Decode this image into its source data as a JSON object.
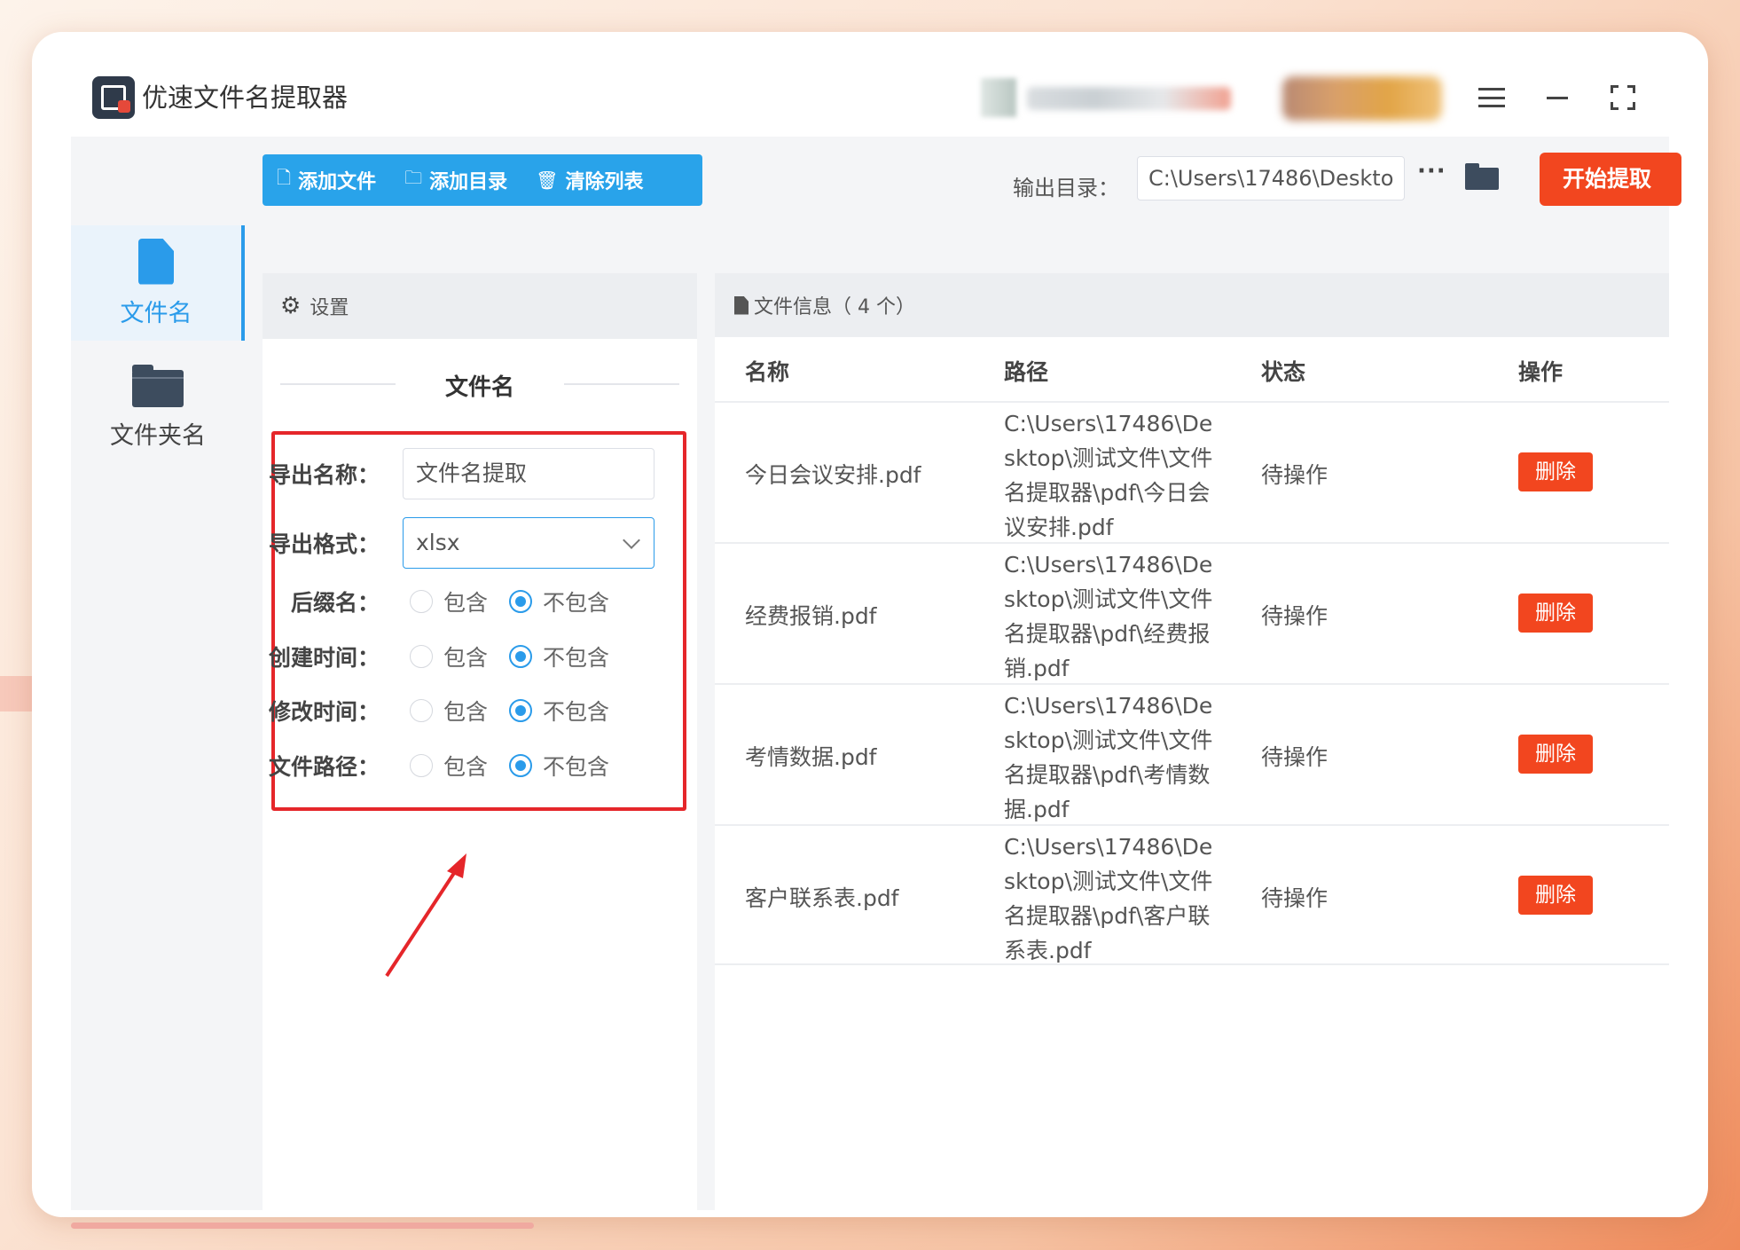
{
  "app": {
    "title": "优速文件名提取器"
  },
  "toolbar": {
    "add_file": "添加文件",
    "add_dir": "添加目录",
    "clear_list": "清除列表",
    "output_label": "输出目录：",
    "output_path": "C:\\Users\\17486\\Deskto",
    "more": "···",
    "start": "开始提取"
  },
  "nav": [
    {
      "label": "文件名",
      "active": true,
      "icon": "file-icon"
    },
    {
      "label": "文件夹名",
      "active": false,
      "icon": "folder-icon"
    }
  ],
  "settings": {
    "header": "设置",
    "section_title": "文件名",
    "export_name_label": "导出名称：",
    "export_name_value": "文件名提取",
    "export_format_label": "导出格式：",
    "export_format_value": "xlsx",
    "include_label": "包含",
    "exclude_label": "不包含",
    "options": [
      {
        "label": "后缀名：",
        "selected": "不包含"
      },
      {
        "label": "创建时间：",
        "selected": "不包含"
      },
      {
        "label": "修改时间：",
        "selected": "不包含"
      },
      {
        "label": "文件路径：",
        "selected": "不包含"
      }
    ]
  },
  "files": {
    "header": "文件信息（ 4 个）",
    "columns": [
      "名称",
      "路径",
      "状态",
      "操作"
    ],
    "delete_label": "删除",
    "rows": [
      {
        "name": "今日会议安排.pdf",
        "path": "C:\\Users\\17486\\Desktop\\测试文件\\文件名提取器\\pdf\\今日会议安排.pdf",
        "status": "待操作"
      },
      {
        "name": "经费报销.pdf",
        "path": "C:\\Users\\17486\\Desktop\\测试文件\\文件名提取器\\pdf\\经费报销.pdf",
        "status": "待操作"
      },
      {
        "name": "考情数据.pdf",
        "path": "C:\\Users\\17486\\Desktop\\测试文件\\文件名提取器\\pdf\\考情数据.pdf",
        "status": "待操作"
      },
      {
        "name": "客户联系表.pdf",
        "path": "C:\\Users\\17486\\Desktop\\测试文件\\文件名提取器\\pdf\\客户联系表.pdf",
        "status": "待操作"
      }
    ]
  },
  "colors": {
    "accent": "#2a9bea",
    "danger": "#f2461f",
    "highlight_box": "#e5262a"
  }
}
